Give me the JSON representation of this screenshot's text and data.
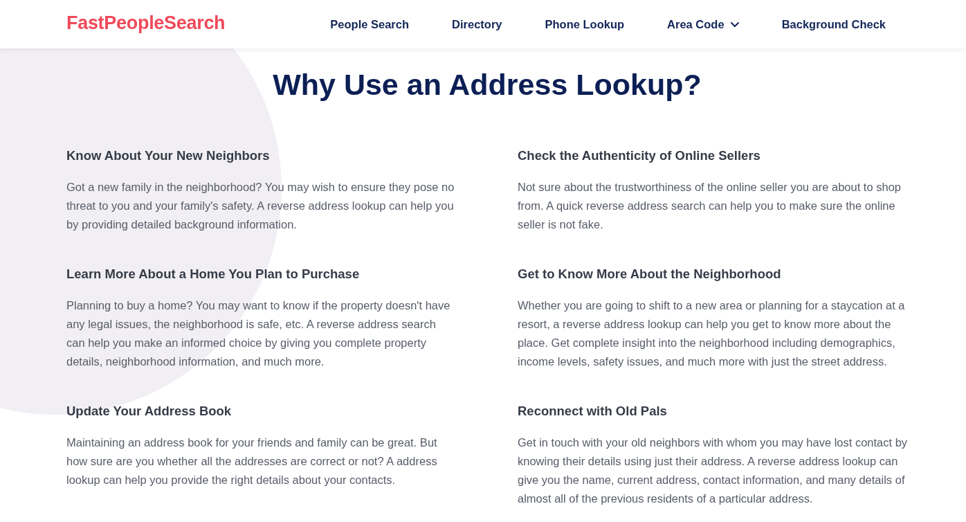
{
  "header": {
    "logo": "FastPeopleSearch",
    "nav": [
      {
        "label": "People Search",
        "kind": "link"
      },
      {
        "label": "Directory",
        "kind": "link"
      },
      {
        "label": "Phone Lookup",
        "kind": "link"
      },
      {
        "label": "Area Code",
        "kind": "dropdown"
      },
      {
        "label": "Background Check",
        "kind": "link"
      }
    ]
  },
  "title": "Why Use an Address Lookup?",
  "sections": [
    {
      "heading": "Know About Your New Neighbors",
      "text": "Got a new family in the neighborhood? You may wish to ensure they pose no threat to you and your family's safety. A reverse address lookup can help you by providing detailed background information."
    },
    {
      "heading": "Check the Authenticity of Online Sellers",
      "text": "Not sure about the trustworthiness of the online seller you are about to shop from. A quick reverse address search can help you to make sure the online seller is not fake."
    },
    {
      "heading": "Learn More About a Home You Plan to Purchase",
      "text": "Planning to buy a home? You may want to know if the property doesn't have any legal issues, the neighborhood is safe, etc. A reverse address search can help you make an informed choice by giving you complete property details, neighborhood information, and much more."
    },
    {
      "heading": "Get to Know More About the Neighborhood",
      "text": "Whether you are going to shift to a new area or planning for a staycation at a resort, a reverse address lookup can help you get to know more about the place. Get complete insight into the neighborhood including demographics, income levels, safety issues, and much more with just the street address."
    },
    {
      "heading": "Update Your Address Book",
      "text": "Maintaining an address book for your friends and family can be great. But how sure are you whether all the addresses are correct or not? A address lookup can help you provide the right details about your contacts."
    },
    {
      "heading": "Reconnect with Old Pals",
      "text": "Get in touch with your old neighbors with whom you may have lost contact by knowing their details using just their address. A reverse address lookup can give you the name, current address, contact information, and many details of almost all of the previous residents of a particular address."
    }
  ]
}
